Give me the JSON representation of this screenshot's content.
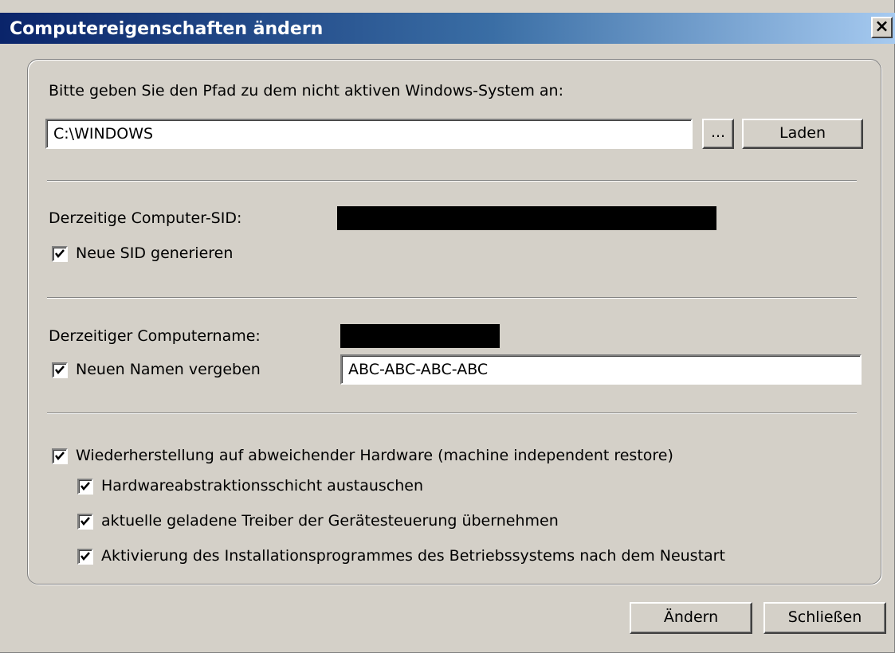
{
  "window": {
    "title": "Computereigenschaften ändern",
    "close_glyph": "×"
  },
  "path_section": {
    "prompt": "Bitte geben Sie den Pfad zu dem nicht aktiven Windows-System an:",
    "path_value": "C:\\WINDOWS",
    "browse_label": "...",
    "load_label": "Laden"
  },
  "sid_section": {
    "current_label": "Derzeitige Computer-SID:",
    "generate_label": "Neue SID generieren",
    "generate_checked": true
  },
  "name_section": {
    "current_label": "Derzeitiger Computername:",
    "rename_label": "Neuen Namen vergeben",
    "rename_checked": true,
    "new_name_value": "ABC-ABC-ABC-ABC"
  },
  "restore_section": {
    "main_label": "Wiederherstellung auf abweichender Hardware (machine independent restore)",
    "main_checked": true,
    "options": [
      {
        "label": "Hardwareabstraktionsschicht austauschen",
        "checked": true
      },
      {
        "label": "aktuelle geladene Treiber der Gerätesteuerung übernehmen",
        "checked": true
      },
      {
        "label": "Aktivierung des Installationsprogrammes des Betriebssystems nach dem Neustart",
        "checked": true
      }
    ]
  },
  "footer": {
    "apply_label": "Ändern",
    "close_label": "Schließen"
  }
}
